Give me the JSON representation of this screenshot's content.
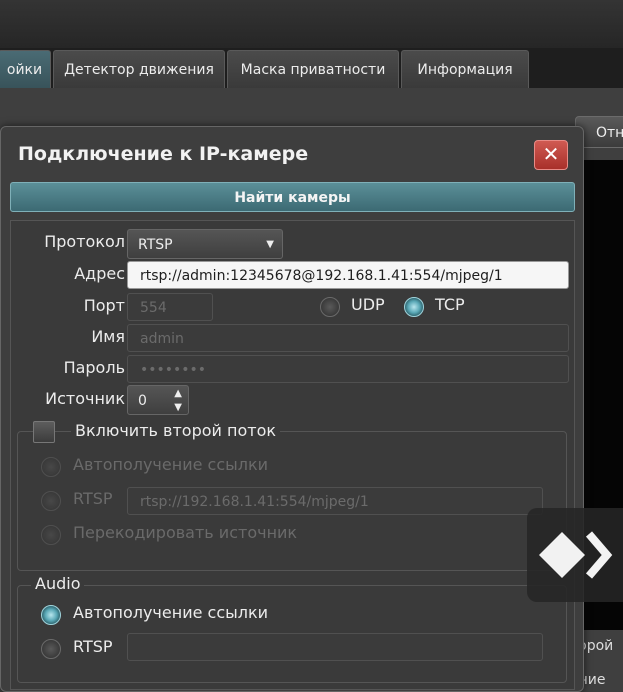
{
  "background": {
    "tabs": [
      {
        "label": "ойки",
        "active": true
      },
      {
        "label": "Детектор движения",
        "active": false
      },
      {
        "label": "Маска приватности",
        "active": false
      },
      {
        "label": "Информация",
        "active": false
      }
    ],
    "right_button_label": "Отн",
    "right_text_1": "торой",
    "right_text_2": "ениe"
  },
  "dialog": {
    "title": "Подключение к IP-камере",
    "close_glyph": "✕",
    "find_cameras_label": "Найти камеры",
    "protocol": {
      "label": "Протокол",
      "value": "RTSP"
    },
    "address": {
      "label": "Адрес",
      "value": "rtsp://admin:12345678@192.168.1.41:554/mjpeg/1"
    },
    "port": {
      "label": "Порт",
      "value": "554"
    },
    "transport": {
      "udp_label": "UDP",
      "tcp_label": "TCP",
      "selected": "TCP"
    },
    "name": {
      "label": "Имя",
      "value": "admin"
    },
    "password": {
      "label": "Пароль",
      "value": "••••••••"
    },
    "source": {
      "label": "Источник",
      "value": "0"
    },
    "second_stream": {
      "checkbox_label": "Включить второй поток",
      "checked": false,
      "auto_label": "Автополучение ссылки",
      "rtsp_label": "RTSP",
      "rtsp_value": "rtsp://192.168.1.41:554/mjpeg/1",
      "transcode_label": "Перекодировать источник"
    },
    "audio": {
      "group_label": "Audio",
      "auto_label": "Автополучение ссылки",
      "rtsp_label": "RTSP",
      "rtsp_value": "",
      "selected": "auto"
    }
  },
  "colors": {
    "accent": "#4f8a94",
    "close": "#b83a33"
  },
  "icons": [
    "close-icon",
    "dropdown-caret-icon",
    "spinner-arrows-icon",
    "next-arrow-icon"
  ]
}
